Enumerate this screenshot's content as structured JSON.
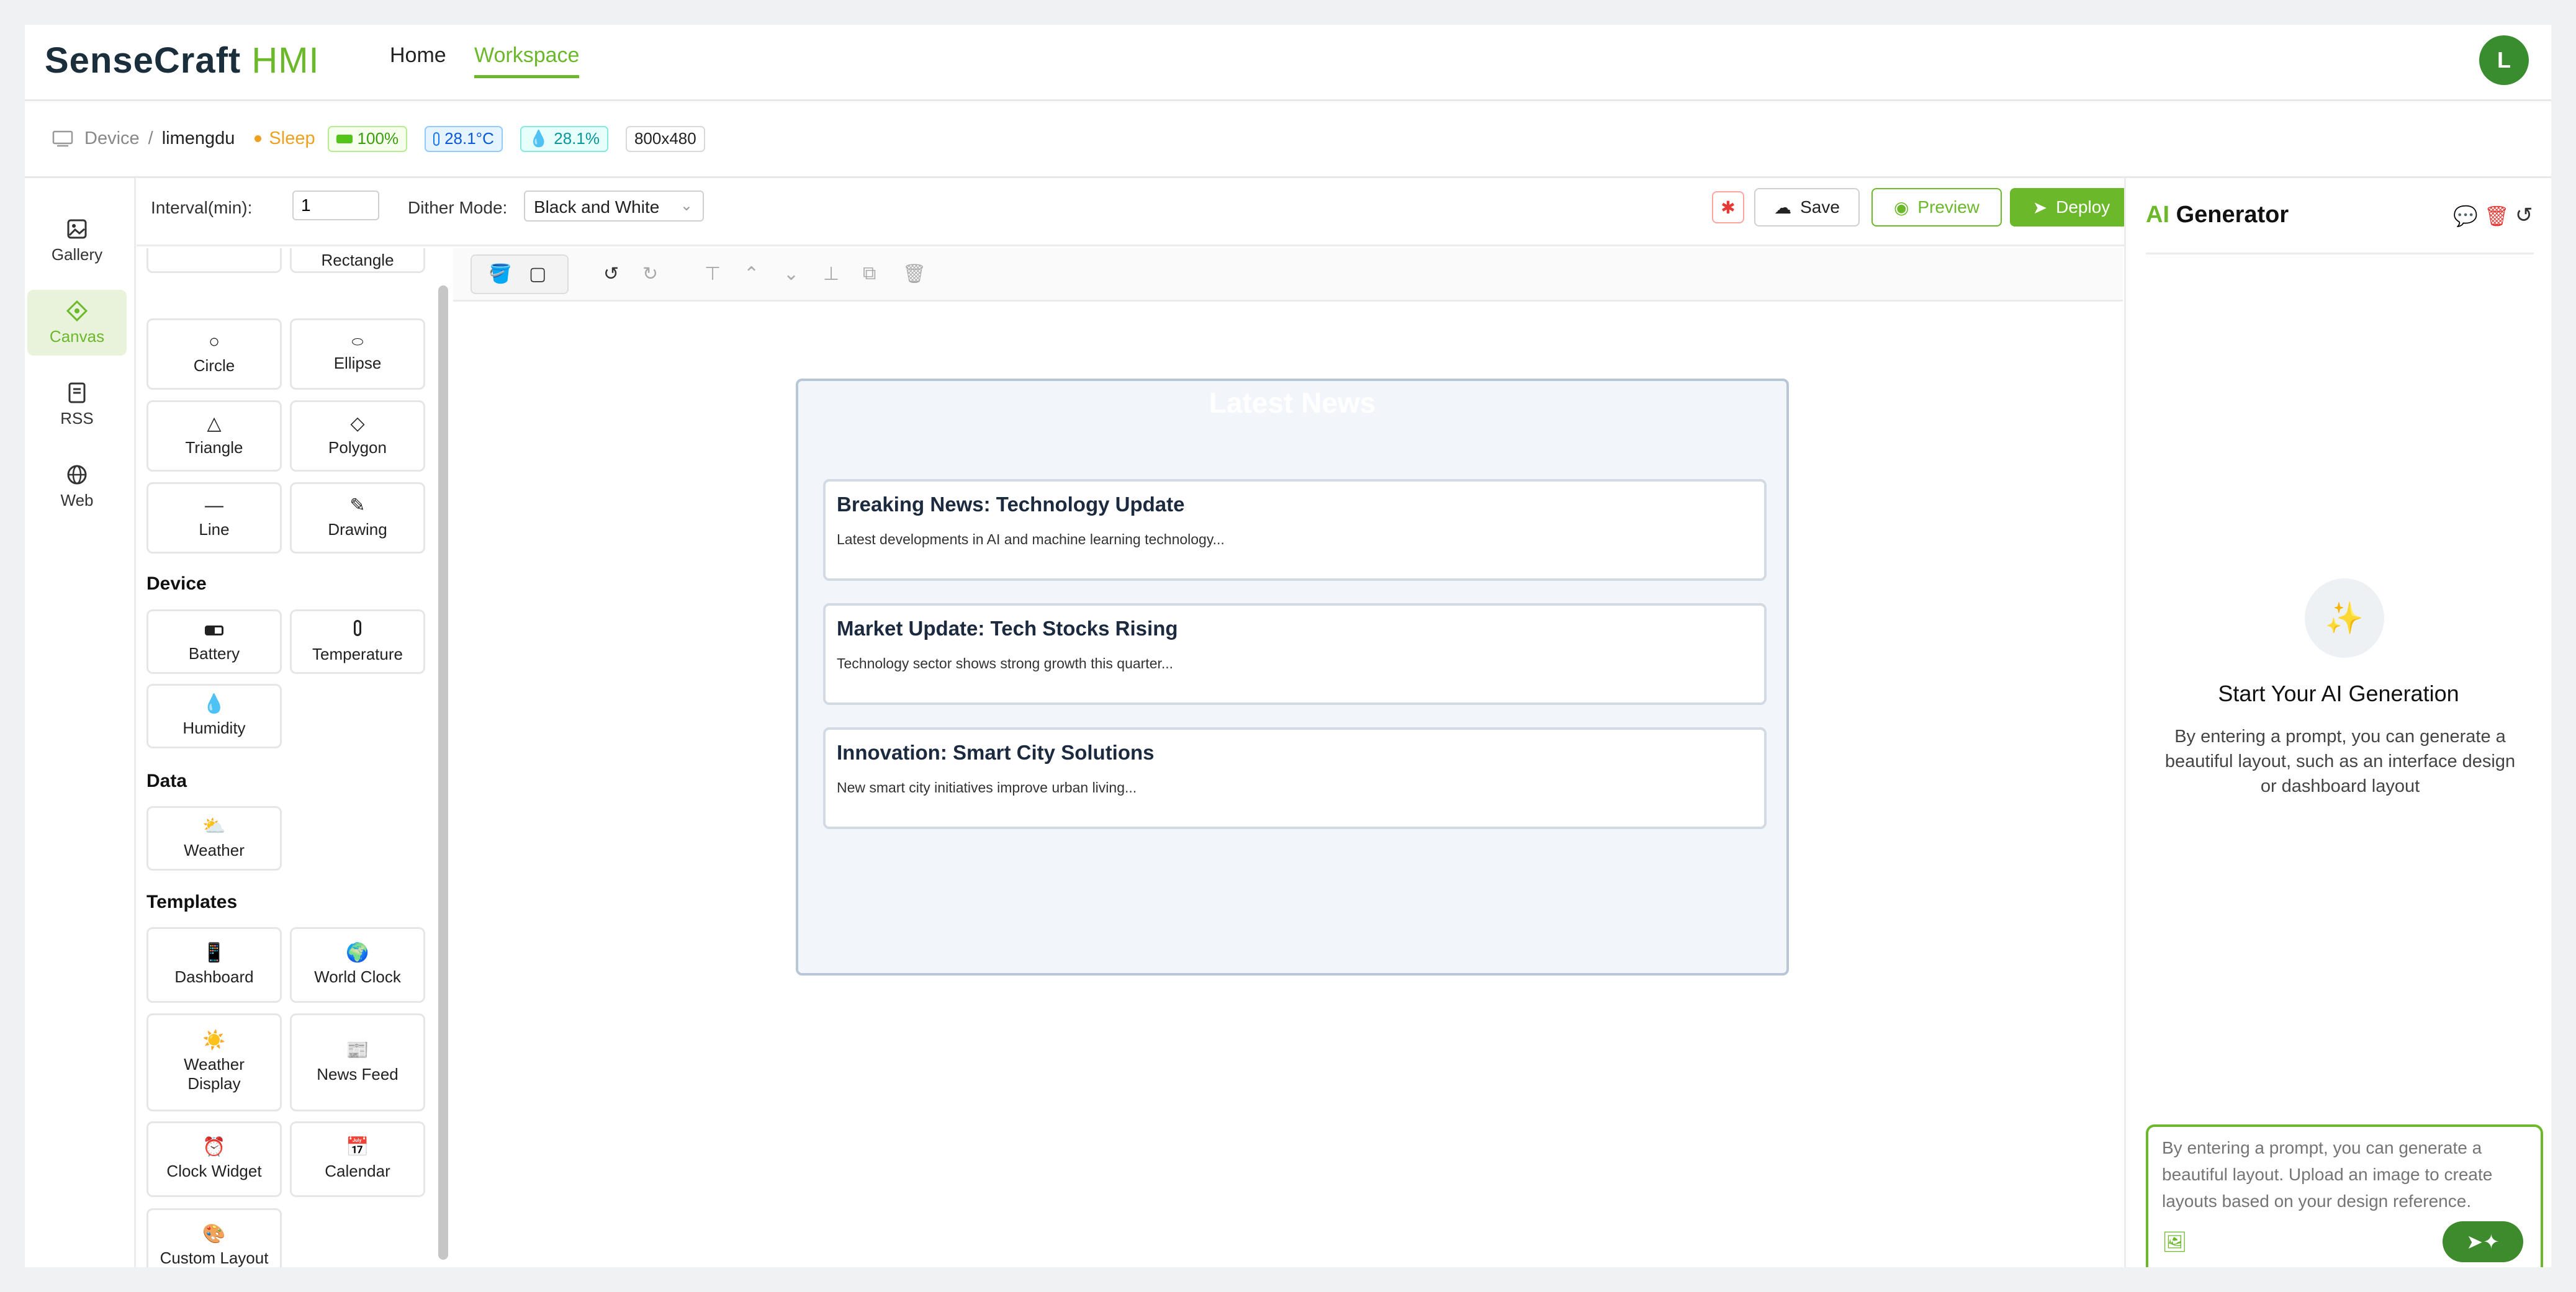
{
  "header": {
    "logo_main": "SenseCraft",
    "logo_suffix": "HMI",
    "nav": [
      "Home",
      "Workspace"
    ],
    "active_nav": "Workspace",
    "avatar_letter": "L"
  },
  "device_bar": {
    "device_label": "Device",
    "separator": "/",
    "device_name": "limengdu",
    "status": "Sleep",
    "battery": "100%",
    "temperature": "28.1°C",
    "humidity": "28.1%",
    "resolution": "800x480",
    "colors": {
      "status": "#f0a020",
      "battery": "#52c41a",
      "temperature": "#1677ff",
      "humidity": "#13a8a8"
    }
  },
  "rail": {
    "items": [
      {
        "label": "Gallery",
        "icon": "image-icon"
      },
      {
        "label": "Canvas",
        "icon": "canvas-icon",
        "active": true
      },
      {
        "label": "RSS",
        "icon": "rss-icon"
      },
      {
        "label": "Web",
        "icon": "globe-icon"
      }
    ]
  },
  "toolbox": {
    "shapes": [
      {
        "label": "Rectangle",
        "icon": "rectangle-icon"
      },
      {
        "label": "Circle",
        "icon": "circle-icon"
      },
      {
        "label": "Ellipse",
        "icon": "ellipse-icon"
      },
      {
        "label": "Triangle",
        "icon": "triangle-icon"
      },
      {
        "label": "Polygon",
        "icon": "polygon-icon"
      },
      {
        "label": "Line",
        "icon": "line-icon"
      },
      {
        "label": "Drawing",
        "icon": "pencil-icon"
      }
    ],
    "device_section": "Device",
    "device_items": [
      {
        "label": "Battery",
        "icon": "battery-icon"
      },
      {
        "label": "Temperature",
        "icon": "thermometer-icon"
      },
      {
        "label": "Humidity",
        "icon": "droplet-icon"
      }
    ],
    "data_section": "Data",
    "data_items": [
      {
        "label": "Weather",
        "icon": "weather-icon"
      }
    ],
    "templates_section": "Templates",
    "templates": [
      {
        "label": "Dashboard",
        "icon": "dashboard-icon"
      },
      {
        "label": "World Clock",
        "icon": "globe-icon"
      },
      {
        "label": "Weather Display",
        "icon": "sun-icon"
      },
      {
        "label": "News Feed",
        "icon": "newspaper-icon"
      },
      {
        "label": "Clock Widget",
        "icon": "alarm-clock-icon"
      },
      {
        "label": "Calendar",
        "icon": "calendar-icon"
      },
      {
        "label": "Custom Layout",
        "icon": "palette-icon"
      }
    ]
  },
  "settings": {
    "interval_label": "Interval(min):",
    "interval_value": "1",
    "dither_label": "Dither Mode:",
    "dither_value": "Black and White",
    "save": "Save",
    "preview": "Preview",
    "deploy": "Deploy"
  },
  "canvas": {
    "title": "Latest News",
    "cards": [
      {
        "headline": "Breaking News: Technology Update",
        "desc": "Latest developments in AI and machine learning technology..."
      },
      {
        "headline": "Market Update: Tech Stocks Rising",
        "desc": "Technology sector shows strong growth this quarter..."
      },
      {
        "headline": "Innovation: Smart City Solutions",
        "desc": "New smart city initiatives improve urban living..."
      }
    ]
  },
  "ai_panel": {
    "title_ai": "AI",
    "title_rest": "Generator",
    "empty_title": "Start Your AI Generation",
    "empty_desc": "By entering a prompt, you can generate a beautiful layout, such as an interface design or dashboard layout",
    "prompt_placeholder": "By entering a prompt, you can generate a beautiful layout. Upload an image to create layouts based on your design reference."
  },
  "accent_color": "#6bb82a"
}
